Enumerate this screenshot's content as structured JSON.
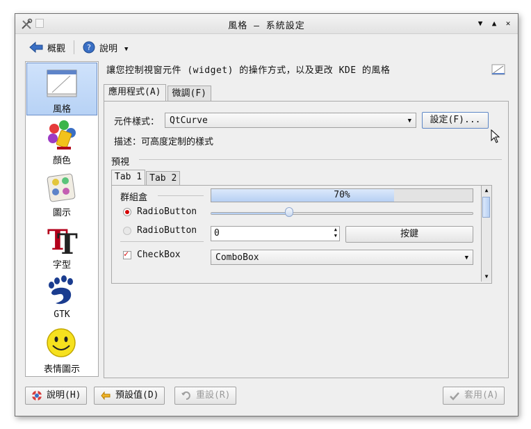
{
  "window": {
    "title": "風格 – 系統設定"
  },
  "toolbar": {
    "overview_label": "概觀",
    "help_label": "說明"
  },
  "sidebar": {
    "items": [
      {
        "label": "風格",
        "icon": "style-icon"
      },
      {
        "label": "顏色",
        "icon": "colors-icon"
      },
      {
        "label": "圖示",
        "icon": "icons-icon"
      },
      {
        "label": "字型",
        "icon": "fonts-icon"
      },
      {
        "label": "GTK",
        "icon": "gtk-icon"
      },
      {
        "label": "表情圖示",
        "icon": "emoticons-icon"
      }
    ],
    "selected": "風格"
  },
  "main": {
    "description": "讓您控制視窗元件 (widget) 的操作方式，以及更改 KDE 的風格",
    "tabs": [
      {
        "label": "應用程式",
        "mnemonic": "(A)"
      },
      {
        "label": "微調",
        "mnemonic": "(F)"
      }
    ],
    "widget_style_label": "元件樣式：",
    "widget_style_value": "QtCurve",
    "configure_button": "設定(F)...",
    "style_description": "描述：可高度定制的樣式",
    "preview_label": "預視"
  },
  "preview": {
    "tabs": [
      "Tab 1",
      "Tab 2"
    ],
    "groupbox_title": "群組盒",
    "radio1": "RadioButton",
    "radio2": "RadioButton",
    "checkbox": "CheckBox",
    "progress_text": "70%",
    "progress_value": 0.7,
    "slider_value": 0.3,
    "spin_value": "0",
    "push_button": "按鍵",
    "combobox_value": "ComboBox"
  },
  "buttons": {
    "help": "說明(H)",
    "defaults": "預設值(D)",
    "reset": "重設(R)",
    "apply": "套用(A)"
  },
  "colors": {
    "accent": "#b7d0f3",
    "selection_border": "#6b8fc8",
    "check_red": "#d40000"
  }
}
